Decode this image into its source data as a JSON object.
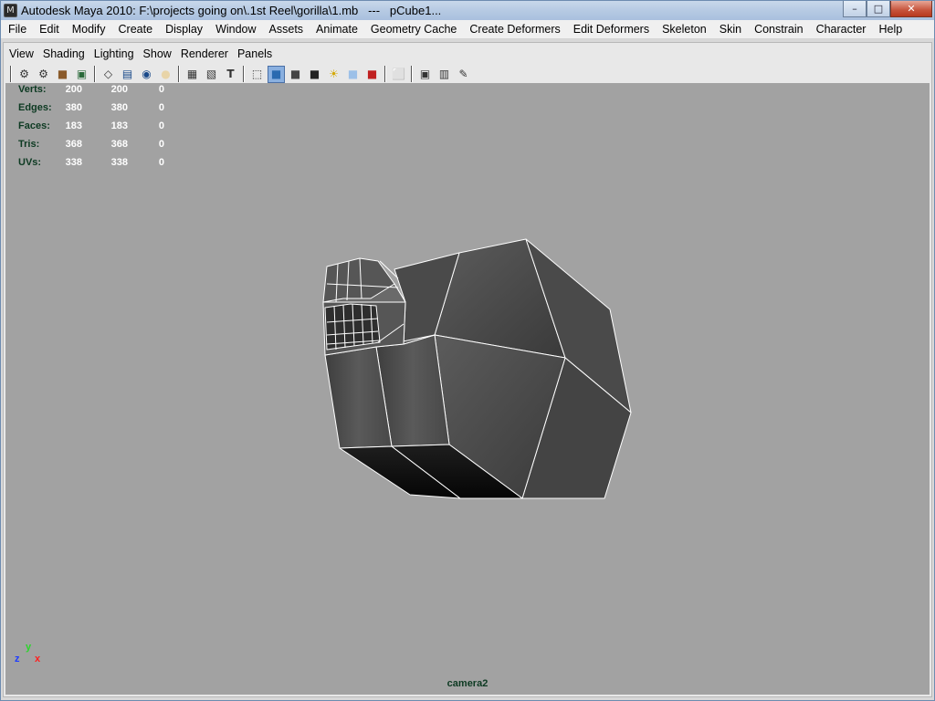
{
  "window": {
    "app_icon": "maya-icon",
    "title": "Autodesk Maya 2010: F:\\projects going on\\.1st Reel\\gorilla\\1.mb   ---   pCube1...",
    "minimize_glyph": "–",
    "maximize_glyph": "□",
    "close_glyph": "✕"
  },
  "menubar": {
    "items": [
      "File",
      "Edit",
      "Modify",
      "Create",
      "Display",
      "Window",
      "Assets",
      "Animate",
      "Geometry Cache",
      "Create Deformers",
      "Edit Deformers",
      "Skeleton",
      "Skin",
      "Constrain",
      "Character",
      "Help"
    ]
  },
  "panel_menu": {
    "items": [
      "View",
      "Shading",
      "Lighting",
      "Show",
      "Renderer",
      "Panels"
    ]
  },
  "toolbar": {
    "icons": [
      {
        "name": "select-camera-icon",
        "glyph": "⚙"
      },
      {
        "name": "camera-attributes-icon",
        "glyph": "⚙"
      },
      {
        "name": "bookmarks-icon",
        "glyph": "■"
      },
      {
        "name": "image-plane-icon",
        "glyph": "▣"
      },
      {
        "name": "grid-icon",
        "glyph": "◇"
      },
      {
        "name": "film-gate-icon",
        "glyph": "▤"
      },
      {
        "name": "resolution-gate-icon",
        "glyph": "◉"
      },
      {
        "name": "gate-mask-icon",
        "glyph": "●"
      },
      {
        "name": "field-chart-icon",
        "glyph": "▦"
      },
      {
        "name": "safe-action-icon",
        "glyph": "▧"
      },
      {
        "name": "safe-title-icon",
        "glyph": "T"
      },
      {
        "name": "wireframe-icon",
        "glyph": "⬚"
      },
      {
        "name": "smooth-shade-icon",
        "glyph": "■"
      },
      {
        "name": "wireframe-on-shaded-icon",
        "glyph": "■"
      },
      {
        "name": "textured-icon",
        "glyph": "■"
      },
      {
        "name": "use-lights-icon",
        "glyph": "☀"
      },
      {
        "name": "xray-icon",
        "glyph": "■"
      },
      {
        "name": "shadows-icon",
        "glyph": "■"
      },
      {
        "name": "isolate-select-icon",
        "glyph": "⬜"
      },
      {
        "name": "xray-joints-icon",
        "glyph": "▣"
      },
      {
        "name": "xray-active-icon",
        "glyph": "▥"
      },
      {
        "name": "hud-icon",
        "glyph": "✎"
      }
    ]
  },
  "hud": {
    "rows": [
      {
        "label": "Verts:",
        "v1": "200",
        "v2": "200",
        "v3": "0"
      },
      {
        "label": "Edges:",
        "v1": "380",
        "v2": "380",
        "v3": "0"
      },
      {
        "label": "Faces:",
        "v1": "183",
        "v2": "183",
        "v3": "0"
      },
      {
        "label": "Tris:",
        "v1": "368",
        "v2": "368",
        "v3": "0"
      },
      {
        "label": "UVs:",
        "v1": "338",
        "v2": "338",
        "v3": "0"
      }
    ]
  },
  "axis": {
    "x": "x",
    "y": "y",
    "z": "z"
  },
  "camera_label": "camera2",
  "colors": {
    "viewport_bg": "#a2a2a2",
    "hud_label": "#0d3a22",
    "hud_value": "#ffffff",
    "axis_x": "#ff2020",
    "axis_y": "#2bd62b",
    "axis_z": "#1e3dff"
  }
}
